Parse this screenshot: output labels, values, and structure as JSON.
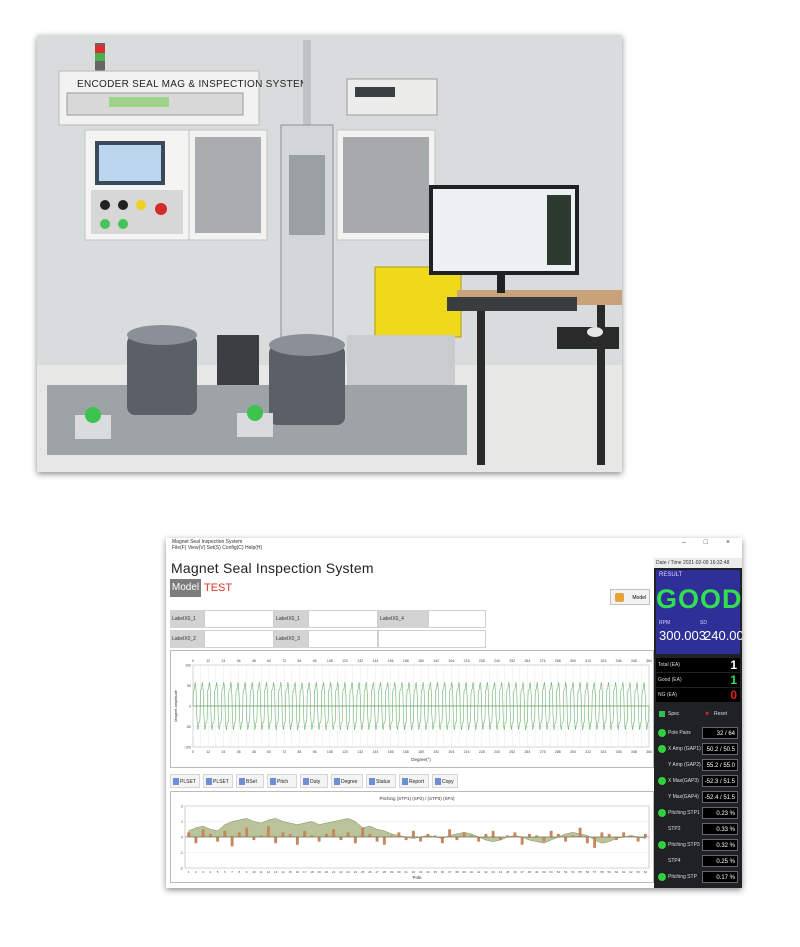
{
  "photo": {
    "machine_label": "ENCODER SEAL MAG & INSPECTION SYSTEM",
    "colors": {
      "wall": "#d9dcdc",
      "frame": "#f1f1f0",
      "base": "#9ea3a8",
      "yellow": "#f0d81a",
      "desk": "#c9a27a"
    }
  },
  "app": {
    "titlebar": {
      "line1": "Magnet Seal Inspection System",
      "line2": "File(F)  View(V)  Set(S)  Config(C)  Help(H)",
      "controls": "– □ ×"
    },
    "title": "Magnet Seal Inspection System",
    "model": {
      "label": "Model :",
      "value": "TEST",
      "button": "Model"
    },
    "labels": [
      {
        "label": "LabelX0_1"
      },
      {
        "label": "LabelX0_1"
      },
      {
        "label": "LabelX0_4"
      },
      {
        "label": "LabelX0_2"
      },
      {
        "label": "LabelX0_3"
      }
    ],
    "toolbar": [
      "PLSET",
      "PLSET",
      "BSet",
      "Pitch",
      "Duty",
      "Degree",
      "Status",
      "Report",
      "Copy"
    ],
    "chart2_title": "Pitching (STP1) (SP2) / (STP3) (SP4)",
    "chart1_xlabel": "Degree(°)",
    "chart2_xlabel": "Pole",
    "right": {
      "datetime": "Date / Time  2021-02-09 16:32:48",
      "result_label": "RESULT",
      "result": "GOOD",
      "rpm_label": "RPM",
      "sd_label": "SD",
      "rpm": "300.003",
      "sd": "240.00",
      "counts": [
        {
          "label": "Total (EA)",
          "value": "1",
          "color": "#ffffff"
        },
        {
          "label": "Good (EA)",
          "value": "1",
          "color": "#30e050"
        },
        {
          "label": "NG (EA)",
          "value": "0",
          "color": "#e02020"
        }
      ],
      "spec_label": "Spec",
      "reset_label": "Reset",
      "measures": [
        {
          "name": "Pole Pairs",
          "value": "32 / 64"
        },
        {
          "name": "X Amp (GAP1)",
          "value": "50.2 / 50.5"
        },
        {
          "name": "Y Amp (GAP2)",
          "value": "55.2 / 55.0"
        },
        {
          "name": "X Max(GAP3)",
          "value": "-52.3 / 51.5"
        },
        {
          "name": "Y Max(GAP4)",
          "value": "-52.4 / 51.5"
        },
        {
          "name": "Pitching STP1",
          "value": "0.23  %"
        },
        {
          "name": "STP2",
          "value": "0.33  %"
        },
        {
          "name": "Pitching STP3",
          "value": "0.32  %"
        },
        {
          "name": "STP4",
          "value": "0.25  %"
        },
        {
          "name": "Pitching STP",
          "value": "0.17  %"
        }
      ]
    }
  },
  "chart_data": [
    {
      "type": "line",
      "title": "",
      "xlabel": "Degree(°)",
      "ylabel": "Magnet amplitude",
      "xlim": [
        0,
        360
      ],
      "ylim": [
        -100,
        100
      ],
      "x_ticks": [
        0,
        6,
        12,
        18,
        24,
        30,
        36,
        42,
        48,
        54,
        60,
        66,
        72,
        78,
        84,
        90,
        96,
        102,
        108,
        114,
        120,
        126,
        132,
        138,
        144,
        150,
        156,
        162,
        168,
        174,
        180,
        186,
        192,
        198,
        204,
        210,
        216,
        222,
        228,
        234,
        240,
        246,
        252,
        258,
        264,
        270,
        276,
        282,
        288,
        294,
        300,
        306,
        312,
        318,
        324,
        330,
        336,
        342,
        348,
        354,
        360
      ],
      "series": [
        {
          "name": "",
          "color": "#3a9a3a",
          "cycles": 64,
          "amplitude": 60
        }
      ]
    },
    {
      "type": "bar",
      "title": "Pitching (STP1) (SP2) / (STP3) (SP4)",
      "xlabel": "Pole",
      "ylim": [
        -2,
        2
      ],
      "categories": [
        1,
        2,
        3,
        4,
        5,
        6,
        7,
        8,
        9,
        10,
        11,
        12,
        13,
        14,
        15,
        16,
        17,
        18,
        19,
        20,
        21,
        22,
        23,
        24,
        25,
        26,
        27,
        28,
        29,
        30,
        31,
        32,
        33,
        34,
        35,
        36,
        37,
        38,
        39,
        40,
        41,
        42,
        43,
        44,
        45,
        46,
        47,
        48,
        49,
        50,
        51,
        52,
        53,
        54,
        55,
        56,
        57,
        58,
        59,
        60,
        61,
        62,
        63,
        64
      ],
      "values": [
        0.3,
        -0.4,
        0.5,
        0.2,
        -0.3,
        0.4,
        -0.6,
        0.3,
        0.6,
        -0.2,
        0.1,
        0.7,
        -0.4,
        0.3,
        0.2,
        -0.5,
        0.4,
        0.1,
        -0.3,
        0.2,
        0.5,
        -0.2,
        0.3,
        -0.4,
        0.6,
        0.2,
        -0.3,
        -0.5,
        0.1,
        0.3,
        -0.2,
        0.4,
        -0.3,
        0.2,
        0.1,
        -0.4,
        0.5,
        -0.2,
        0.3,
        0.1,
        -0.3,
        0.2,
        0.4,
        -0.2,
        0.1,
        0.3,
        -0.5,
        0.2,
        0.1,
        -0.3,
        0.4,
        0.2,
        -0.3,
        0.1,
        0.6,
        -0.4,
        -0.7,
        0.3,
        0.2,
        -0.2,
        0.3,
        0.1,
        -0.3,
        0.2
      ],
      "area": [
        0.4,
        0.6,
        0.7,
        0.5,
        0.4,
        0.8,
        1.0,
        1.1,
        1.2,
        1.0,
        0.9,
        1.1,
        1.2,
        1.0,
        0.9,
        0.8,
        0.9,
        1.0,
        0.8,
        0.9,
        1.0,
        1.1,
        1.2,
        1.0,
        0.6,
        0.7,
        0.5,
        0.4,
        0.2,
        0.1,
        0.0,
        -0.1,
        0.0,
        0.1,
        0.0,
        -0.1,
        0.1,
        0.2,
        0.3,
        0.2,
        0.0,
        -0.2,
        -0.3,
        -0.2,
        0.0,
        0.1,
        0.0,
        -0.2,
        -0.3,
        -0.4,
        -0.2,
        0.0,
        0.2,
        0.3,
        0.2,
        0.1,
        -0.2,
        -0.4,
        -0.3,
        -0.1,
        0.0,
        0.1,
        0.0,
        -0.1
      ],
      "bar_color": "#c8875a",
      "area_color": "#a3b07a"
    }
  ]
}
